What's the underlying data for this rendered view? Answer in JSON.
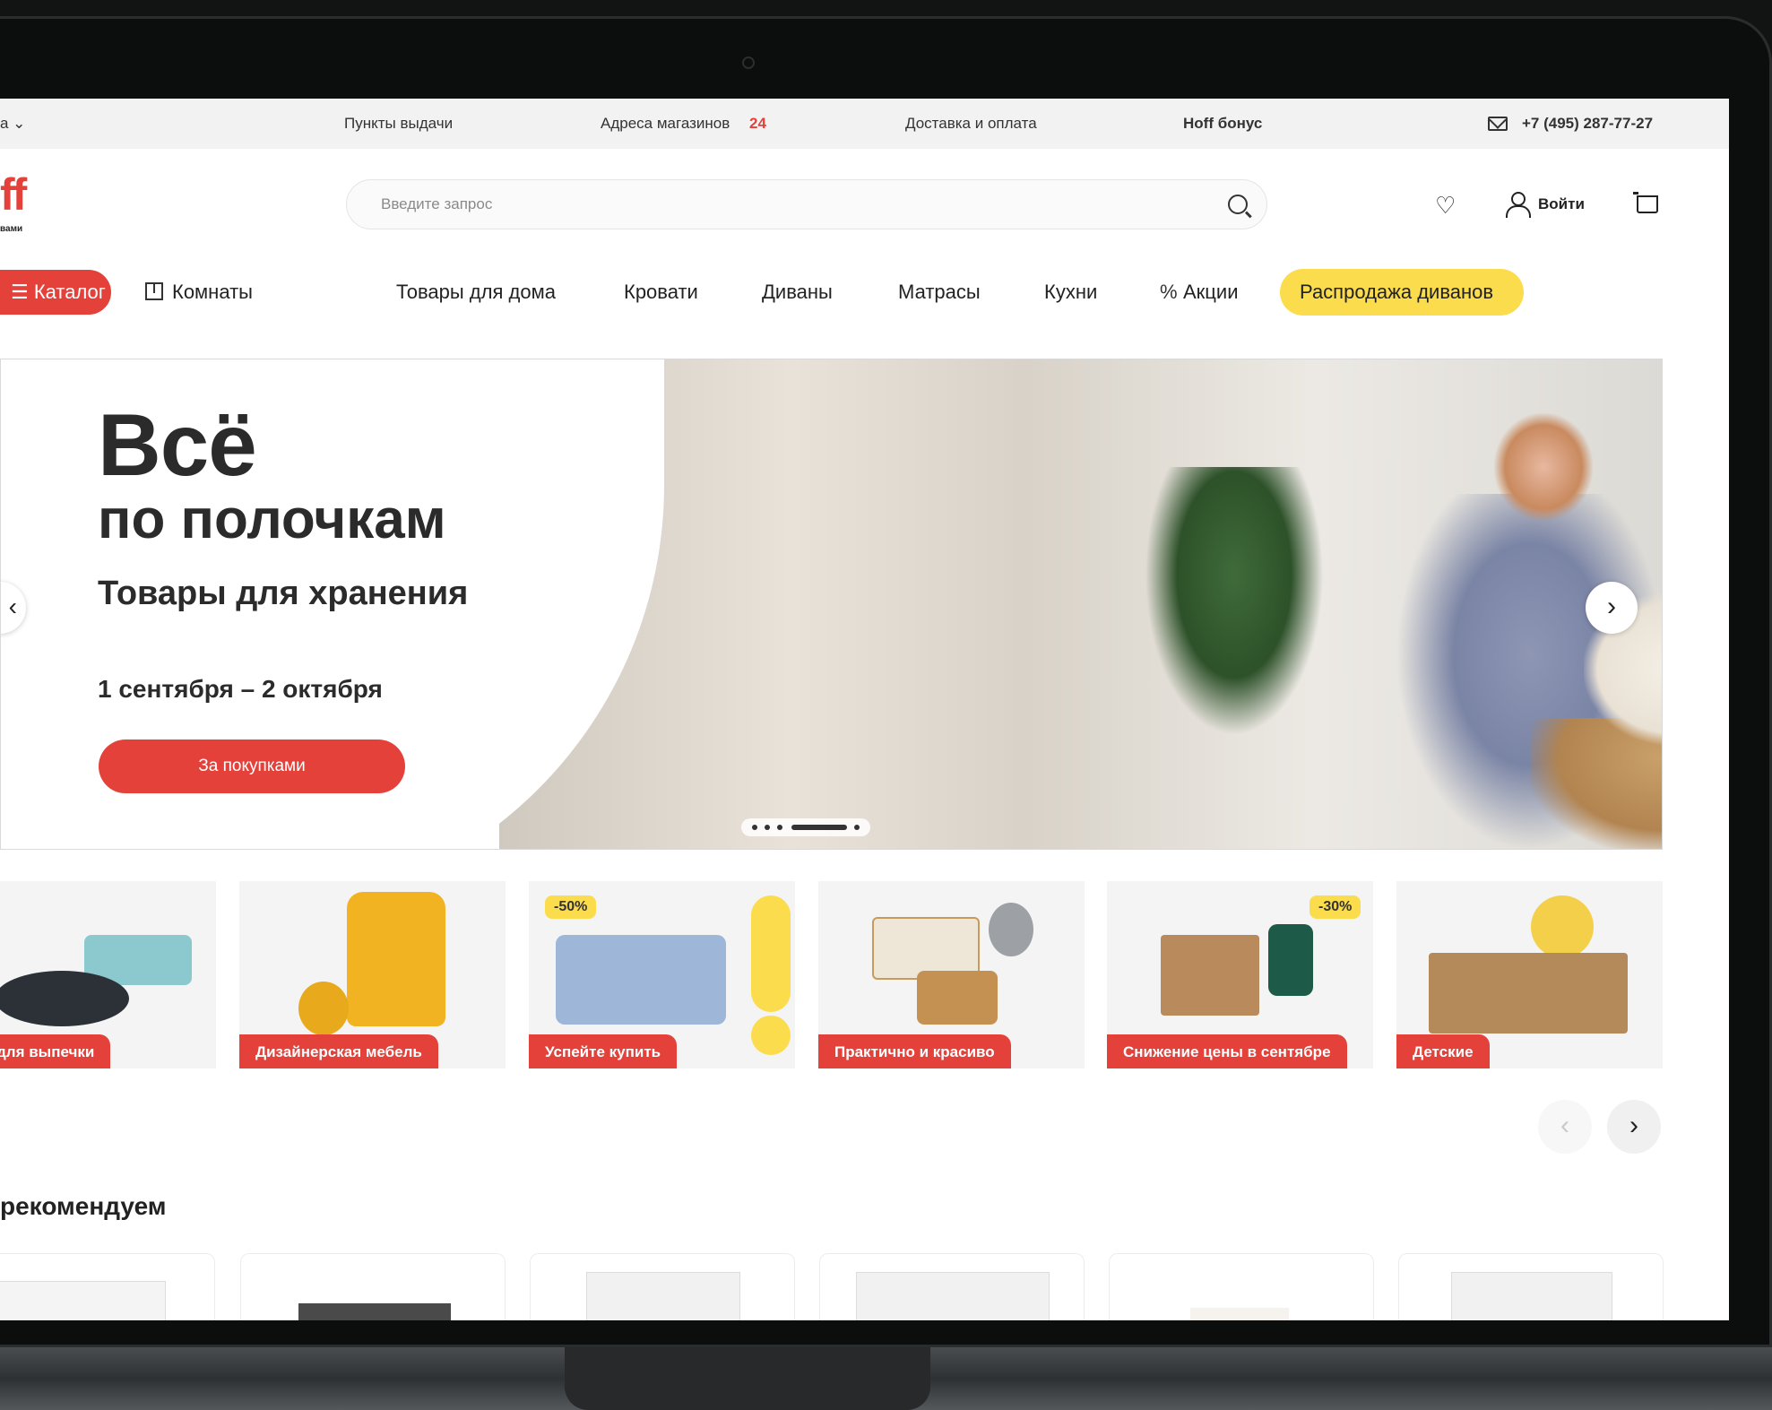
{
  "topbar": {
    "city": "а ⌄",
    "pickup": "Пункты выдачи",
    "stores": "Адреса магазинов",
    "stores_count": "24",
    "delivery": "Доставка и оплата",
    "bonus": "Hoff бонус",
    "phone": "+7 (495) 287-77-27",
    "mail_icon": "mail-icon"
  },
  "header": {
    "logo": "ff",
    "logo_sub": "вами",
    "search_placeholder": "Введите запрос",
    "search_icon": "search-icon",
    "favorites_icon": "heart-icon",
    "user_icon": "user-icon",
    "login": "Войти",
    "cart_icon": "cart-icon"
  },
  "nav": {
    "catalog": "Каталог",
    "rooms": "Комнаты",
    "items": [
      "Товары для дома",
      "Кровати",
      "Диваны",
      "Матрасы",
      "Кухни"
    ],
    "promo": "Акции",
    "sale": "Распродажа диванов",
    "sale_color": "#fbdc4d",
    "accent_color": "#e4413a"
  },
  "hero": {
    "title": "Всё",
    "title2": "по полочкам",
    "subtitle": "Товары для хранения",
    "dates": "1 сентября – 2 октября",
    "button": "За покупками",
    "prev": "‹",
    "next": "›",
    "slides_total": 6,
    "slide_active": 4
  },
  "categories": [
    {
      "label": "уда для выпечки",
      "badge": ""
    },
    {
      "label": "Дизайнерская мебель",
      "badge": ""
    },
    {
      "label": "Успейте купить",
      "badge": "-50%"
    },
    {
      "label": "Практично и красиво",
      "badge": ""
    },
    {
      "label": "Снижение цены в сентябре",
      "badge": "-30%"
    },
    {
      "label": "Детские",
      "badge": ""
    }
  ],
  "carousel": {
    "prev": "‹",
    "next": "›"
  },
  "recommend": {
    "title": "рекомендуем",
    "cards_count": 6
  }
}
